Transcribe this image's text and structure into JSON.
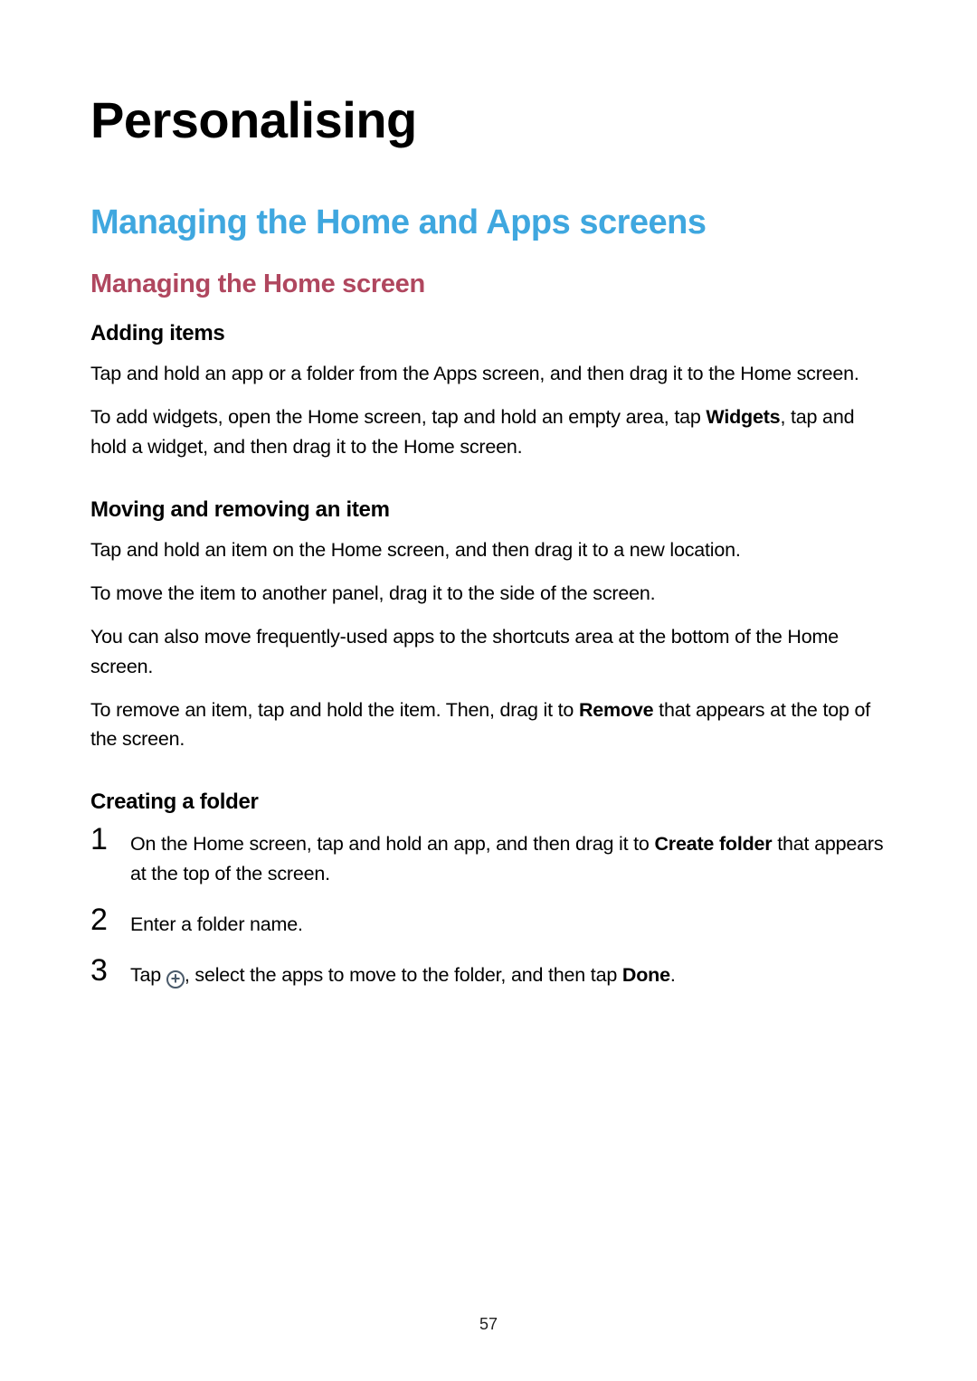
{
  "title": "Personalising",
  "h1": "Managing the Home and Apps screens",
  "h2": "Managing the Home screen",
  "sections": {
    "adding": {
      "heading": "Adding items",
      "p1": "Tap and hold an app or a folder from the Apps screen, and then drag it to the Home screen.",
      "p2_a": "To add widgets, open the Home screen, tap and hold an empty area, tap ",
      "p2_bold": "Widgets",
      "p2_b": ", tap and hold a widget, and then drag it to the Home screen."
    },
    "moving": {
      "heading": "Moving and removing an item",
      "p1": "Tap and hold an item on the Home screen, and then drag it to a new location.",
      "p2": "To move the item to another panel, drag it to the side of the screen.",
      "p3": "You can also move frequently-used apps to the shortcuts area at the bottom of the Home screen.",
      "p4_a": "To remove an item, tap and hold the item. Then, drag it to ",
      "p4_bold": "Remove",
      "p4_b": " that appears at the top of the screen."
    },
    "folder": {
      "heading": "Creating a folder",
      "step1_a": "On the Home screen, tap and hold an app, and then drag it to ",
      "step1_bold": "Create folder",
      "step1_b": " that appears at the top of the screen.",
      "step2": "Enter a folder name.",
      "step3_a": "Tap ",
      "step3_b": ", select the apps to move to the folder, and then tap ",
      "step3_bold": "Done",
      "step3_c": "."
    }
  },
  "num1": "1",
  "num2": "2",
  "num3": "3",
  "page_number": "57"
}
